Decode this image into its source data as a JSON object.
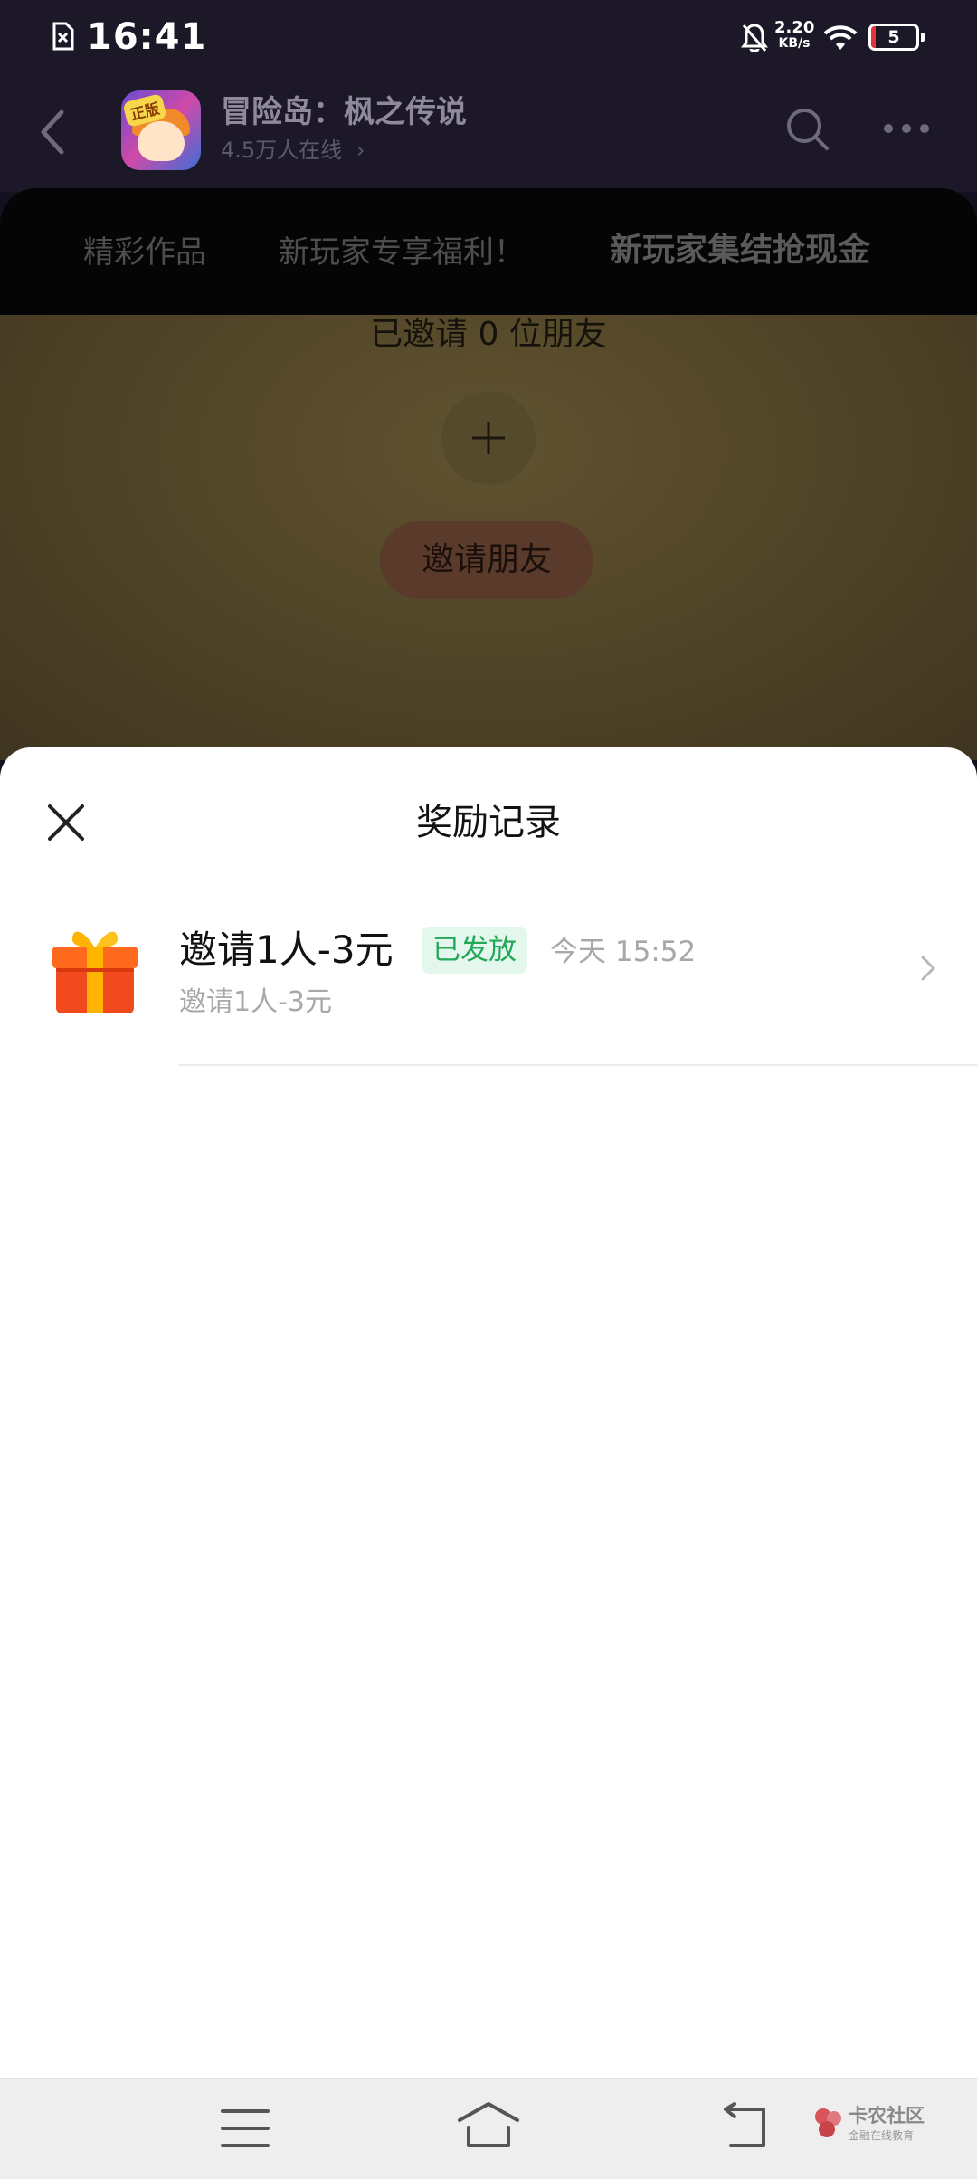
{
  "status_bar": {
    "time": "16:41",
    "net_speed_value": "2.20",
    "net_speed_unit": "KB/s",
    "battery": "5"
  },
  "header": {
    "app_title": "冒险岛：枫之传说",
    "online_count": "4.5万人在线",
    "avatar_tag": "正版"
  },
  "tabs": [
    {
      "label": "精彩作品"
    },
    {
      "label": "新玩家专享福利！"
    },
    {
      "label": "新玩家集结抢现金",
      "active": true
    }
  ],
  "invite_panel": {
    "invited_count": "已邀请 0 位朋友",
    "invite_button": "邀请朋友"
  },
  "sheet": {
    "title": "奖励记录",
    "records": [
      {
        "title": "邀请1人-3元",
        "status": "已发放",
        "time": "今天 15:52",
        "subtitle": "邀请1人-3元"
      }
    ]
  },
  "watermark": {
    "name": "卡农社区",
    "tagline": "金融在线教育"
  },
  "colors": {
    "status_green": "#23a85a",
    "status_green_bg": "#e4f7ec",
    "gift_red": "#f04a1e",
    "gift_gold": "#ffb400"
  }
}
